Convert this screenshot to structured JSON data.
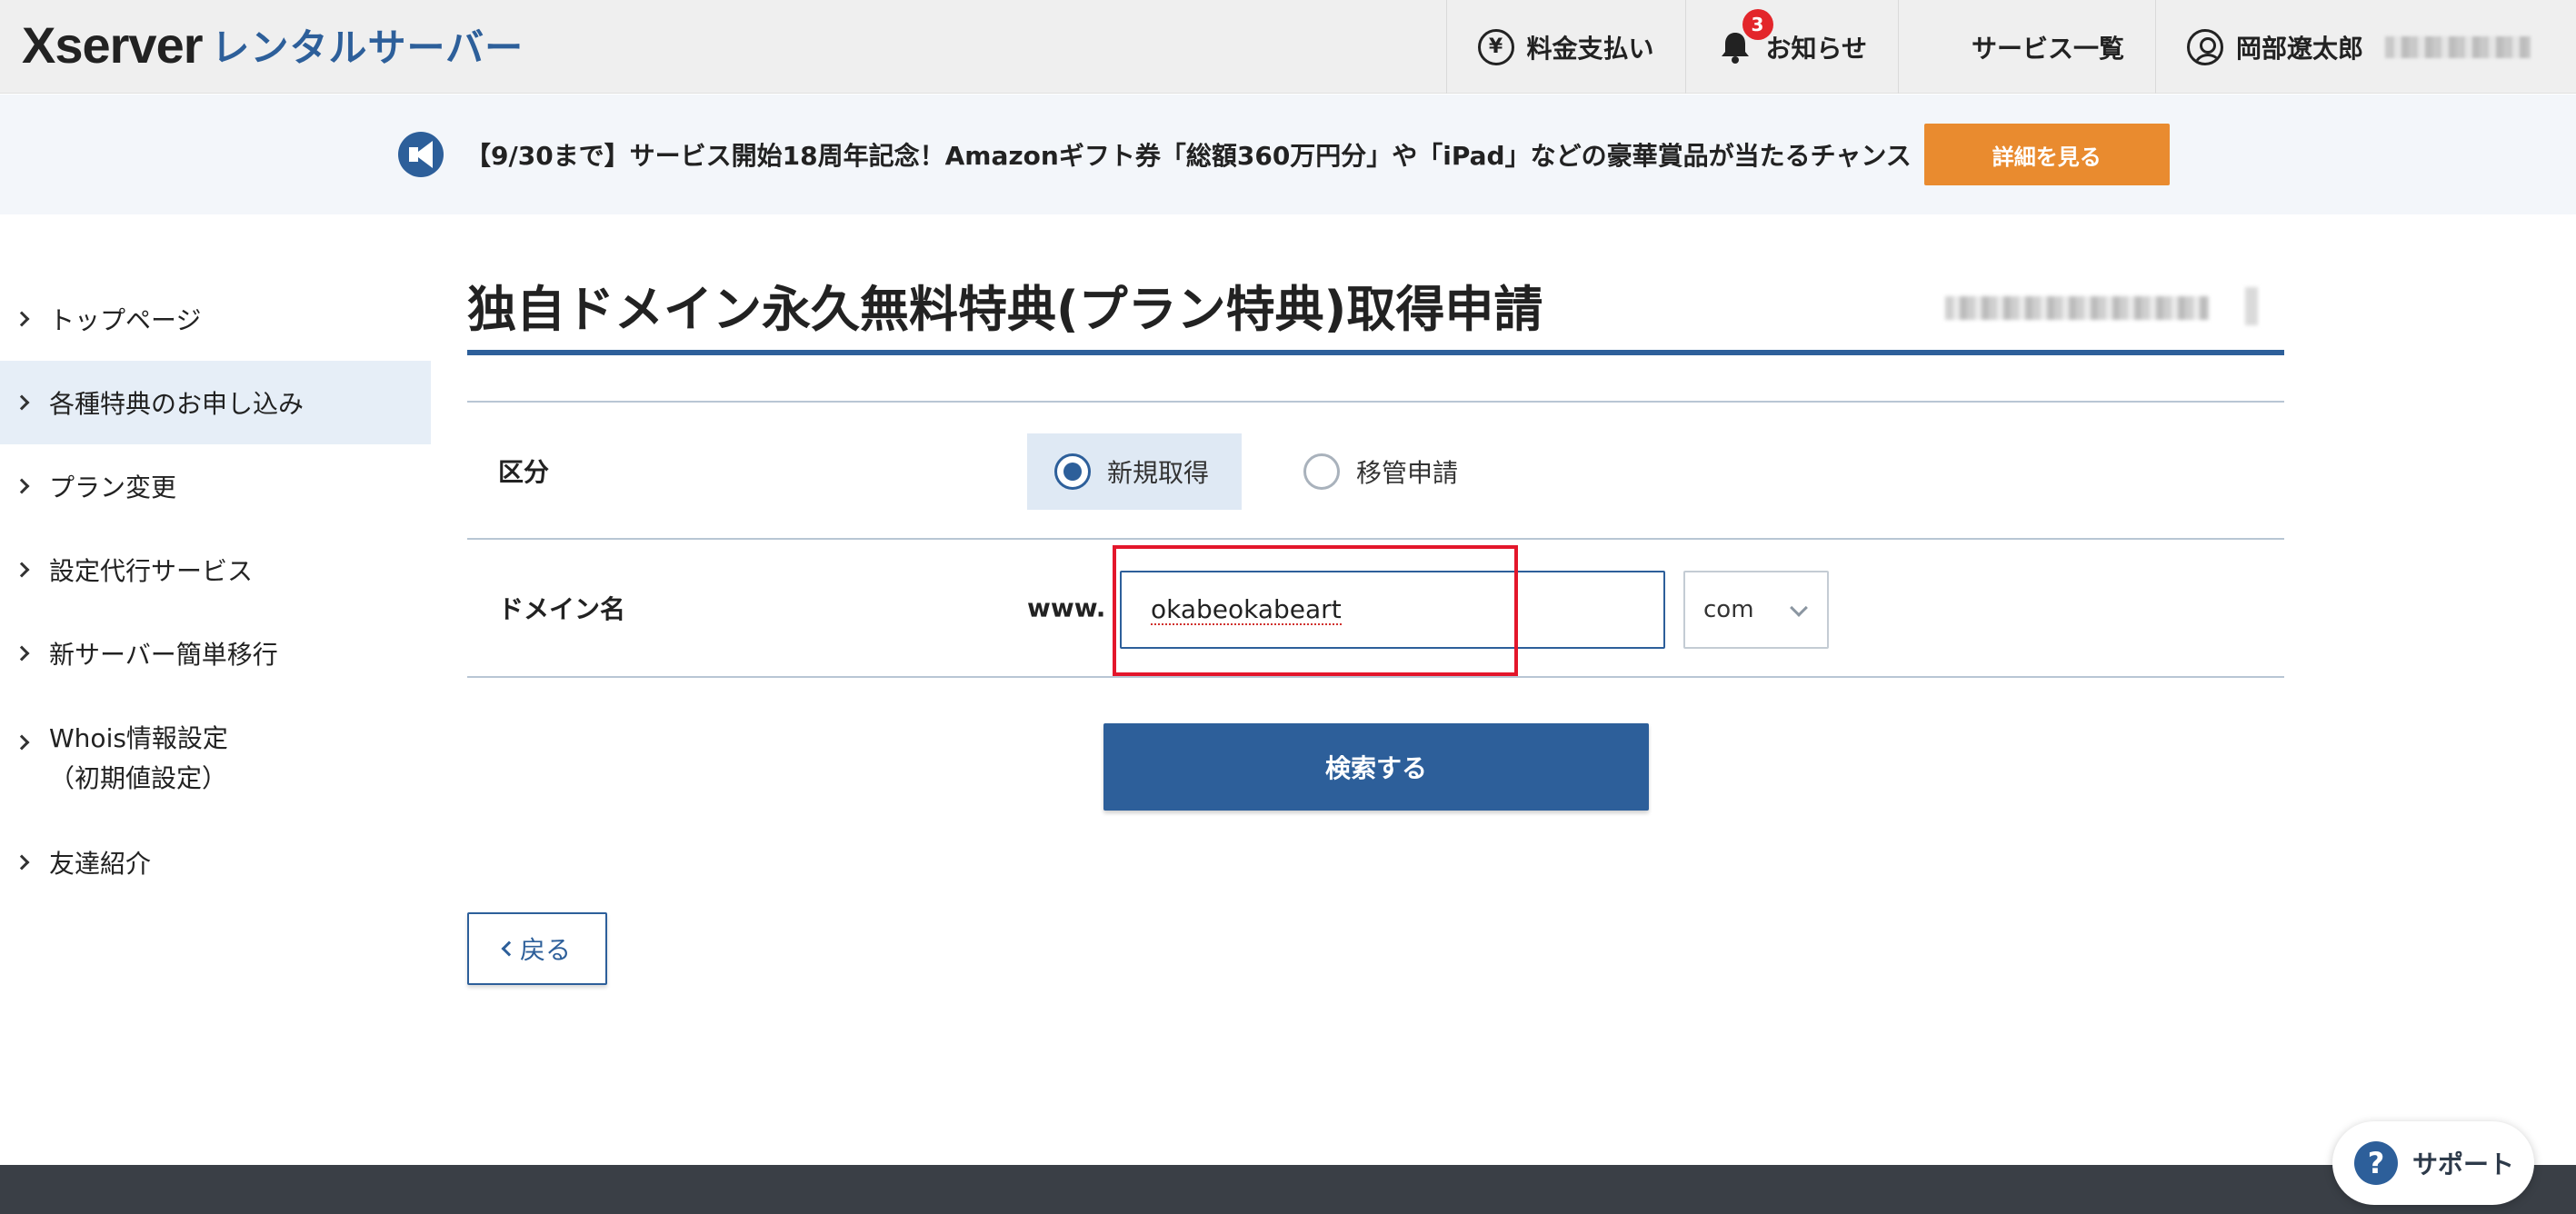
{
  "header": {
    "logo_main": "Xserver",
    "logo_sub": "レンタルサーバー",
    "nav": {
      "billing": "料金支払い",
      "notifications": "お知らせ",
      "notification_count": "3",
      "services": "サービス一覧",
      "user_name": "岡部遼太郎"
    }
  },
  "announcement": {
    "text": "【9/30まで】サービス開始18周年記念！Amazonギフト券「総額360万円分」や「iPad」などの豪華賞品が当たるチャンス",
    "button": "詳細を見る"
  },
  "sidebar": {
    "items": [
      {
        "label": "トップページ"
      },
      {
        "label": "各種特典のお申し込み",
        "active": true
      },
      {
        "label": "プラン変更"
      },
      {
        "label": "設定代行サービス"
      },
      {
        "label": "新サーバー簡単移行"
      },
      {
        "label": "Whois情報設定",
        "label2": "（初期値設定）"
      },
      {
        "label": "友達紹介"
      }
    ]
  },
  "main": {
    "title": "独自ドメイン永久無料特典(プラン特典)取得申請",
    "form": {
      "type_label": "区分",
      "type_options": [
        "新規取得",
        "移管申請"
      ],
      "type_selected": "新規取得",
      "domain_label": "ドメイン名",
      "domain_prefix": "www.",
      "domain_value": "okabeokabeart",
      "tld_value": "com"
    },
    "search_button": "検索する",
    "back_button": "戻る"
  },
  "support": {
    "label": "サポート",
    "icon_glyph": "?"
  },
  "colors": {
    "brand_blue": "#2d5f9a",
    "accent_orange": "#e98b2f",
    "highlight_red": "#e3162b",
    "badge_red": "#e3262b"
  }
}
